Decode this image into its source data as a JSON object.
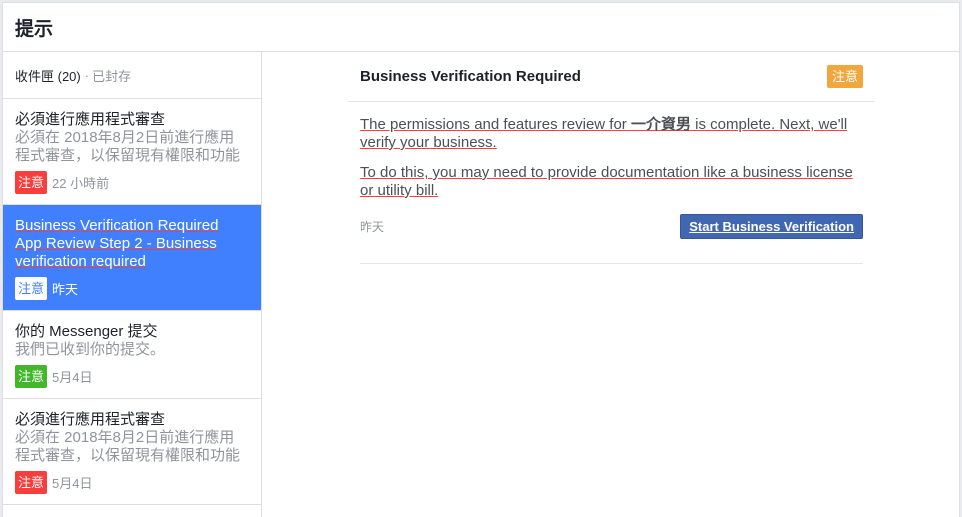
{
  "header": {
    "title": "提示"
  },
  "inbox": {
    "label": "收件匣 (20)",
    "separator": "·",
    "archived": "已封存"
  },
  "items": [
    {
      "title": "必須進行應用程式審查",
      "desc": "必須在 2018年8月2日前進行應用程式審查，以保留現有權限和功能",
      "badge": "注意",
      "time": "22 小時前"
    },
    {
      "title": "Business Verification Required",
      "desc": "App Review Step 2 - Business verification required",
      "badge": "注意",
      "time": "昨天"
    },
    {
      "title": "你的 Messenger 提交",
      "desc": "我們已收到你的提交。",
      "badge": "注意",
      "time": "5月4日"
    },
    {
      "title": "必須進行應用程式審查",
      "desc": "必須在 2018年8月2日前進行應用程式審查，以保留現有權限和功能",
      "badge": "注意",
      "time": "5月4日"
    }
  ],
  "detail": {
    "title": "Business Verification Required",
    "badge": "注意",
    "p1_pre": "The permissions and features review for ",
    "p1_bold": "一介資男",
    "p1_post": " is complete. Next, we'll verify your business.",
    "p2": "To do this, you may need to provide documentation like a business license or utility bill.",
    "date": "昨天",
    "button": "Start Business Verification"
  },
  "colors": {
    "accent": "#4080ff",
    "button": "#4267b2",
    "red": "#fa3e3e",
    "green": "#42b72a",
    "orange": "#f0a73d"
  }
}
